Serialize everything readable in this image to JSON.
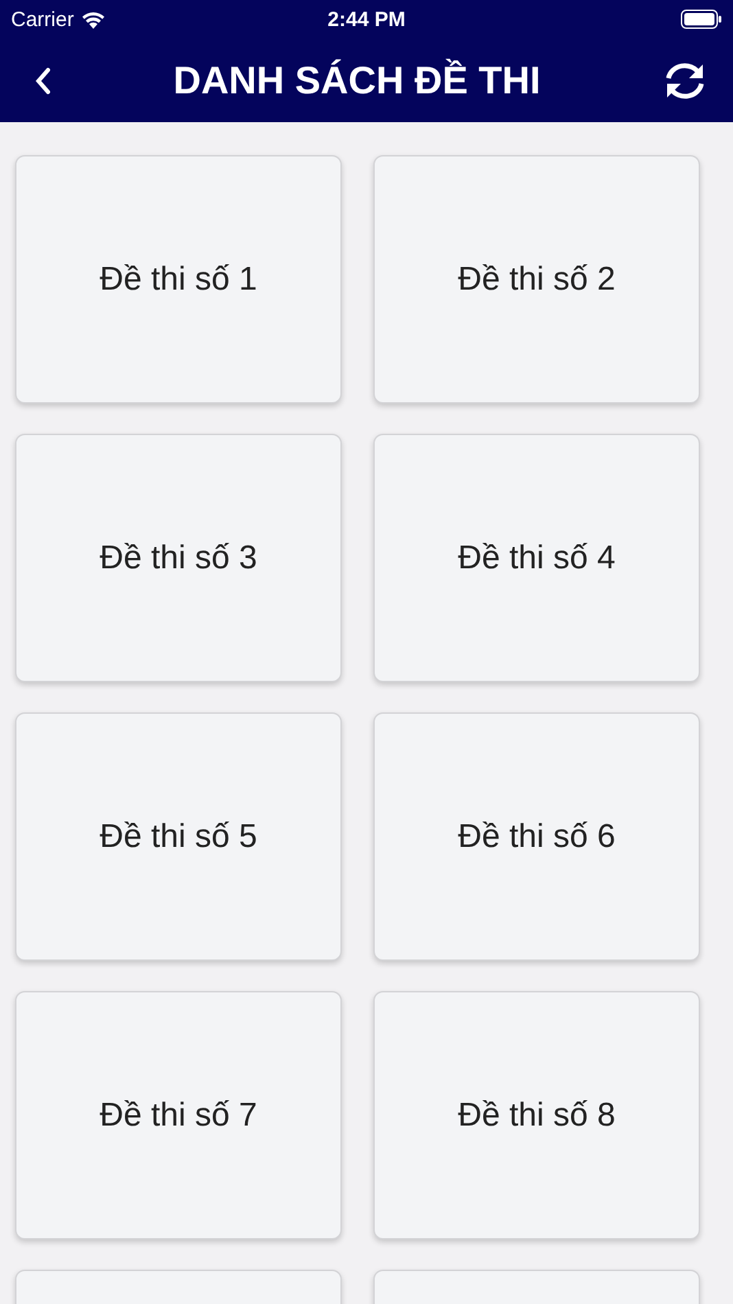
{
  "status_bar": {
    "carrier": "Carrier",
    "time": "2:44 PM"
  },
  "header": {
    "title": "DANH SÁCH ĐỀ THI"
  },
  "exams": [
    {
      "label": "Đề thi số 1"
    },
    {
      "label": "Đề thi số 2"
    },
    {
      "label": "Đề thi số 3"
    },
    {
      "label": "Đề thi số 4"
    },
    {
      "label": "Đề thi số 5"
    },
    {
      "label": "Đề thi số 6"
    },
    {
      "label": "Đề thi số 7"
    },
    {
      "label": "Đề thi số 8"
    }
  ],
  "cut_off_cards": [
    {
      "kind": "card"
    },
    {
      "kind": "card"
    }
  ]
}
